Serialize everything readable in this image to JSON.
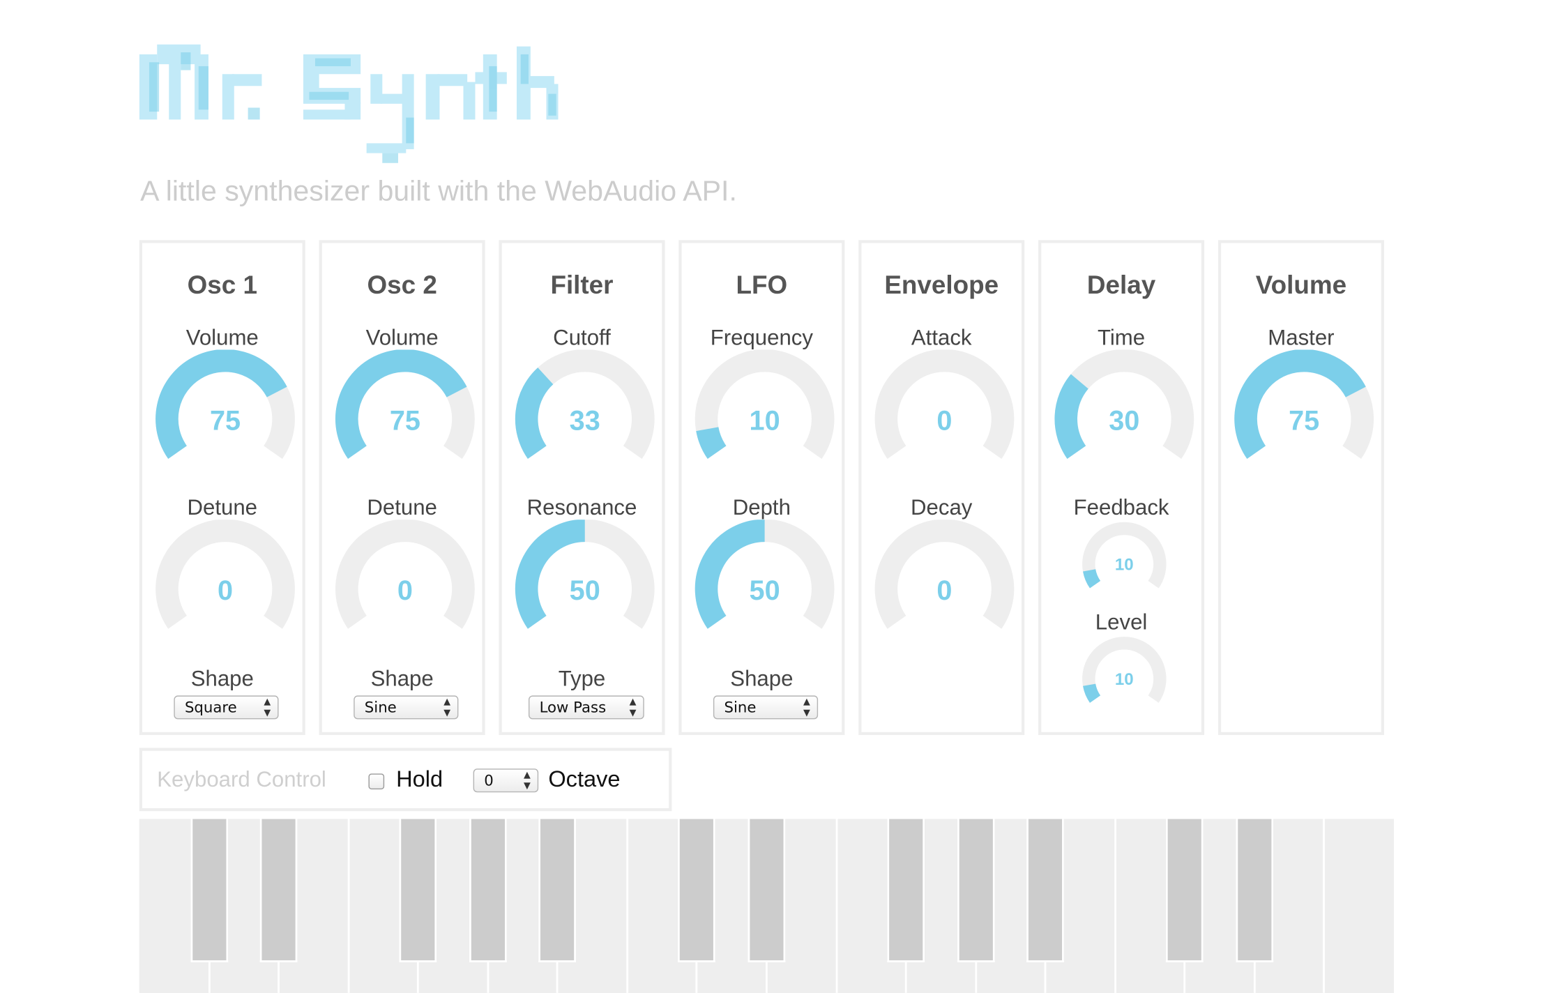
{
  "app": {
    "title": "Mr. Synth",
    "subtitle": "A little synthesizer built with the WebAudio API."
  },
  "theme": {
    "accent": "#7ccfea",
    "track": "#eeeeee",
    "panel_border": "#eeeeee",
    "black_key": "#cccccc"
  },
  "panels": [
    {
      "title": "Osc 1",
      "controls": [
        {
          "label": "Volume",
          "value": "75",
          "level": 0.75
        },
        {
          "label": "Detune",
          "value": "0",
          "level": 0
        }
      ],
      "select": {
        "label": "Shape",
        "value": "Square"
      }
    },
    {
      "title": "Osc 2",
      "controls": [
        {
          "label": "Volume",
          "value": "75",
          "level": 0.75
        },
        {
          "label": "Detune",
          "value": "0",
          "level": 0
        }
      ],
      "select": {
        "label": "Shape",
        "value": "Sine"
      }
    },
    {
      "title": "Filter",
      "controls": [
        {
          "label": "Cutoff",
          "value": "33",
          "level": 0.33
        },
        {
          "label": "Resonance",
          "value": "50",
          "level": 0.5
        }
      ],
      "select": {
        "label": "Type",
        "value": "Low Pass"
      }
    },
    {
      "title": "LFO",
      "controls": [
        {
          "label": "Frequency",
          "value": "10",
          "level": 0.1
        },
        {
          "label": "Depth",
          "value": "50",
          "level": 0.5
        }
      ],
      "select": {
        "label": "Shape",
        "value": "Sine"
      }
    },
    {
      "title": "Envelope",
      "controls": [
        {
          "label": "Attack",
          "value": "0",
          "level": 0
        },
        {
          "label": "Decay",
          "value": "0",
          "level": 0
        }
      ]
    },
    {
      "title": "Delay",
      "controls": [
        {
          "label": "Time",
          "value": "30",
          "level": 0.3
        },
        {
          "label": "Feedback",
          "value": "10",
          "level": 0.1
        },
        {
          "label": "Level",
          "value": "10",
          "level": 0.1
        }
      ]
    },
    {
      "title": "Volume",
      "controls": [
        {
          "label": "Master",
          "value": "75",
          "level": 0.75
        }
      ]
    }
  ],
  "keyboard_control": {
    "title": "Keyboard Control",
    "hold_label": "Hold",
    "hold_checked": false,
    "octave_value": "0",
    "octave_label": "Octave"
  }
}
